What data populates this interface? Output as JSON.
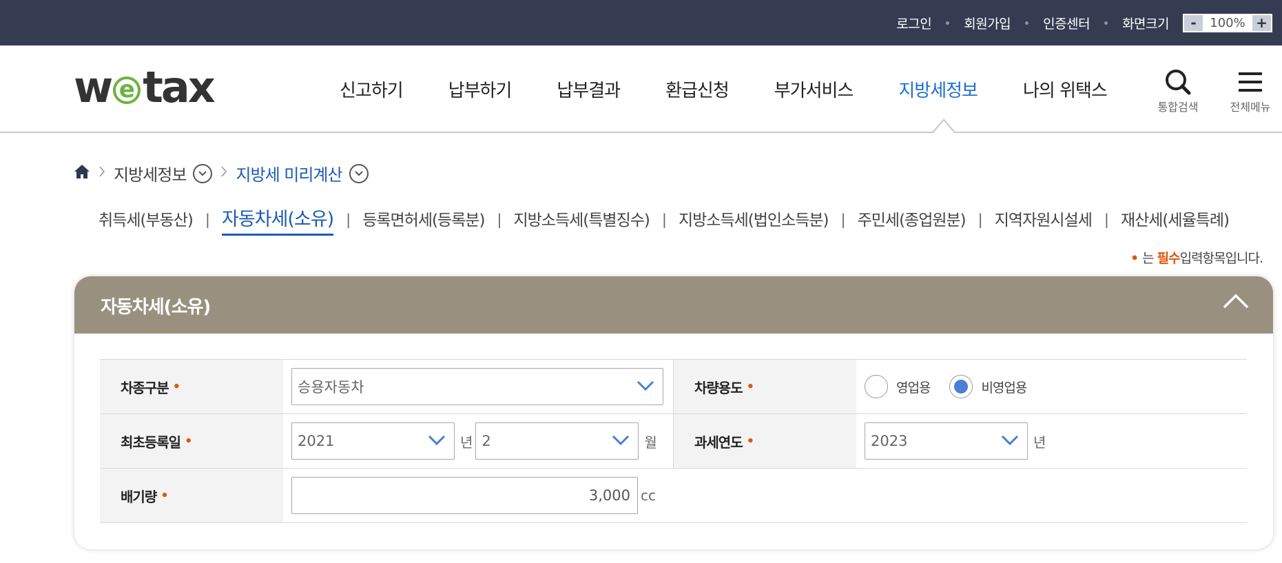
{
  "topbar": {
    "links": [
      "로그인",
      "회원가입",
      "인증센터",
      "화면크기"
    ],
    "zoom_minus": "-",
    "zoom_value": "100%",
    "zoom_plus": "+"
  },
  "header": {
    "logo_left": "w",
    "logo_e": "e",
    "logo_right": "tax",
    "nav": [
      "신고하기",
      "납부하기",
      "납부결과",
      "환급신청",
      "부가서비스",
      "지방세정보",
      "나의 위택스"
    ],
    "active_nav": "지방세정보",
    "search_label": "통합검색",
    "menu_label": "전체메뉴"
  },
  "breadcrumb": {
    "level1": "지방세정보",
    "level2": "지방세 미리계산"
  },
  "tabs": [
    "취득세(부동산)",
    "자동차세(소유)",
    "등록면허세(등록분)",
    "지방소득세(특별징수)",
    "지방소득세(법인소득분)",
    "주민세(종업원분)",
    "지역자원시설세",
    "재산세(세율특례)"
  ],
  "active_tab": "자동차세(소유)",
  "required_note": {
    "dot": "•",
    "prefix": "는",
    "strong": "필수",
    "suffix": "입력항목입니다."
  },
  "panel": {
    "title": "자동차세(소유)",
    "required_mark": "•",
    "vehicle_type": {
      "label": "차종구분",
      "value": "승용자동차"
    },
    "vehicle_use": {
      "label": "차량용도",
      "options": [
        "영업용",
        "비영업용"
      ],
      "selected": "비영업용"
    },
    "first_registration": {
      "label": "최초등록일",
      "year": "2021",
      "year_unit": "년",
      "month": "2",
      "month_unit": "월"
    },
    "tax_year": {
      "label": "과세연도",
      "value": "2023",
      "unit": "년"
    },
    "displacement": {
      "label": "배기량",
      "value": "3,000",
      "unit": "cc"
    }
  },
  "colors": {
    "topbar": "#353c52",
    "accent_blue": "#1d6ed1",
    "panel_header": "#9a9080",
    "required_orange": "#e0570a"
  }
}
